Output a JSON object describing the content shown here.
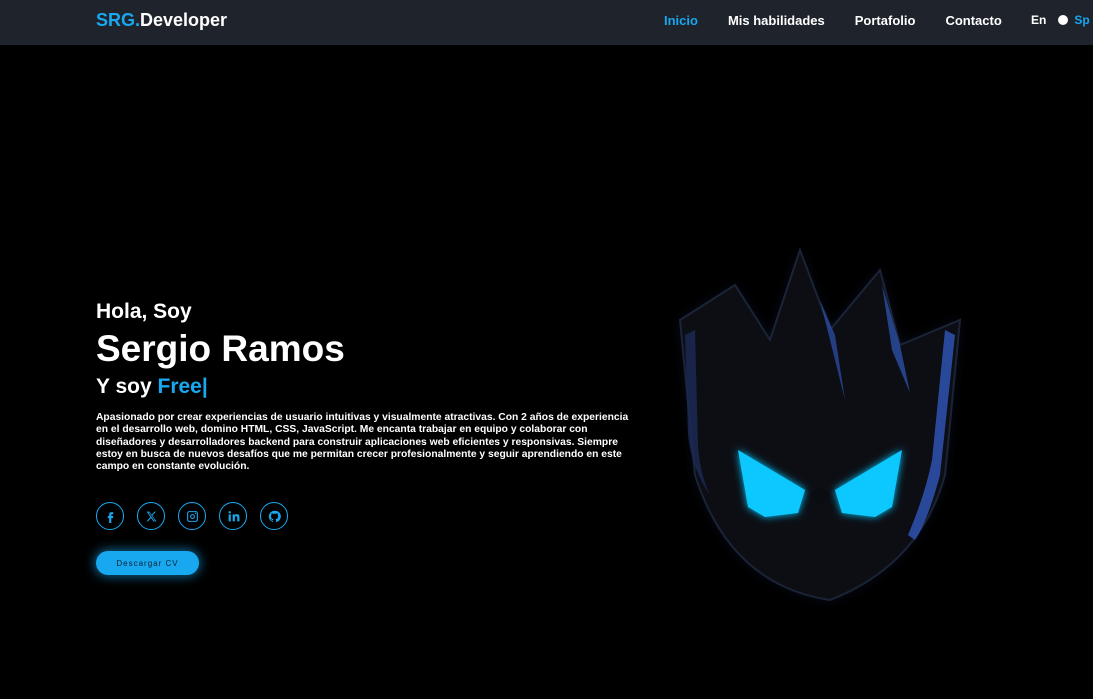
{
  "header": {
    "logo_accent": "SRG.",
    "logo_rest": "Developer",
    "nav": [
      {
        "label": "Inicio",
        "active": true
      },
      {
        "label": "Mis habilidades",
        "active": false
      },
      {
        "label": "Portafolio",
        "active": false
      },
      {
        "label": "Contacto",
        "active": false
      }
    ],
    "lang": {
      "en": "En",
      "sp": "Sp",
      "selected": "Sp"
    }
  },
  "hero": {
    "greeting": "Hola, Soy",
    "name": "Sergio Ramos",
    "role_prefix": "Y soy",
    "role_typed": "Free|",
    "bio": "Apasionado por crear experiencias de usuario intuitivas y visualmente atractivas. Con 2 años de experiencia en el desarrollo web, domino HTML, CSS, JavaScript. Me encanta trabajar en equipo y colaborar con diseñadores y desarrolladores backend para construir aplicaciones web eficientes y responsivas. Siempre estoy en busca de nuevos desafíos que me permitan crecer profesionalmente y seguir aprendiendo en este campo en constante evolución.",
    "socials": [
      {
        "icon": "facebook-icon"
      },
      {
        "icon": "x-twitter-icon"
      },
      {
        "icon": "instagram-icon"
      },
      {
        "icon": "linkedin-icon"
      },
      {
        "icon": "github-icon"
      }
    ],
    "cv_button": "Descargar CV"
  },
  "colors": {
    "accent": "#17a8f0",
    "header_bg": "#1f232b",
    "background": "#000000"
  }
}
